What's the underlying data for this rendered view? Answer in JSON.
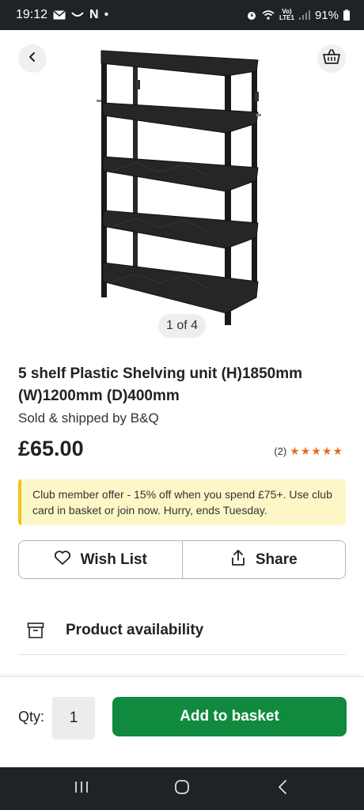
{
  "status_bar": {
    "time": "19:12",
    "n_indicator": "N",
    "dot": "•",
    "network_top": "Vo)",
    "network_bottom": "LTE1",
    "battery": "91%"
  },
  "gallery": {
    "pager": "1 of 4"
  },
  "product": {
    "title": "5 shelf Plastic Shelving unit (H)1850mm (W)1200mm (D)400mm",
    "seller": "Sold & shipped by B&Q",
    "price": "£65.00",
    "rating_count": "(2)",
    "stars": "★★★★★"
  },
  "offer": {
    "text": "Club member offer - 15% off when you spend £75+. Use club card in basket or join now. Hurry, ends Tuesday."
  },
  "actions": {
    "wishlist": "Wish List",
    "share": "Share"
  },
  "availability": {
    "label": "Product availability"
  },
  "purchase": {
    "qty_label": "Qty:",
    "qty_value": "1",
    "add_button": "Add to basket"
  },
  "colors": {
    "primary_green": "#0f8a3f",
    "offer_bg": "#fdf7c8",
    "offer_accent": "#f3c21b",
    "star": "#e86d1f"
  }
}
